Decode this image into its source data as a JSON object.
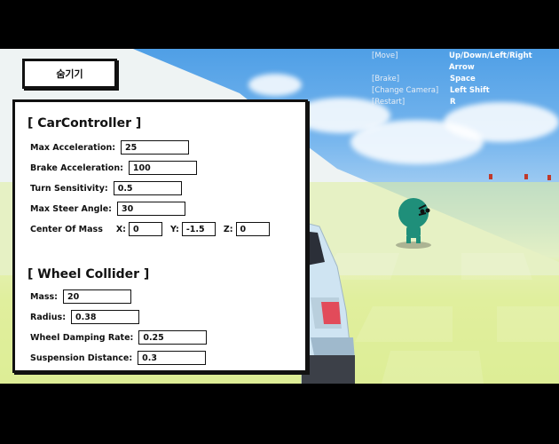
{
  "hide_button": {
    "label": "숨기기"
  },
  "controls": [
    {
      "action": "[Move]",
      "key": "Up/Down/Left/Right Arrow"
    },
    {
      "action": "[Brake]",
      "key": "Space"
    },
    {
      "action": "[Change Camera]",
      "key": "Left Shift"
    },
    {
      "action": "[Restart]",
      "key": "R"
    }
  ],
  "car_controller": {
    "title": "[ CarController ]",
    "max_acceleration": {
      "label": "Max Acceleration:",
      "value": "25"
    },
    "brake_acceleration": {
      "label": "Brake Acceleration:",
      "value": "100"
    },
    "turn_sensitivity": {
      "label": "Turn Sensitivity:",
      "value": "0.5"
    },
    "max_steer_angle": {
      "label": "Max Steer Angle:",
      "value": "30"
    },
    "center_of_mass": {
      "label": "Center Of Mass",
      "x_label": "X:",
      "x": "0",
      "y_label": "Y:",
      "y": "-1.5",
      "z_label": "Z:",
      "z": "0"
    }
  },
  "wheel_collider": {
    "title": "[ Wheel Collider ]",
    "mass": {
      "label": "Mass:",
      "value": "20"
    },
    "radius": {
      "label": "Radius:",
      "value": "0.38"
    },
    "wheel_damping_rate": {
      "label": "Wheel Damping Rate:",
      "value": "0.25"
    },
    "suspension_distance": {
      "label": "Suspension Distance:",
      "value": "0.3"
    }
  },
  "colors": {
    "sky_top": "#4f9fe6",
    "ground": "#d9ec8e",
    "character": "#1f8f7a",
    "car": "#cfe4f2",
    "panel_border": "#111111"
  }
}
